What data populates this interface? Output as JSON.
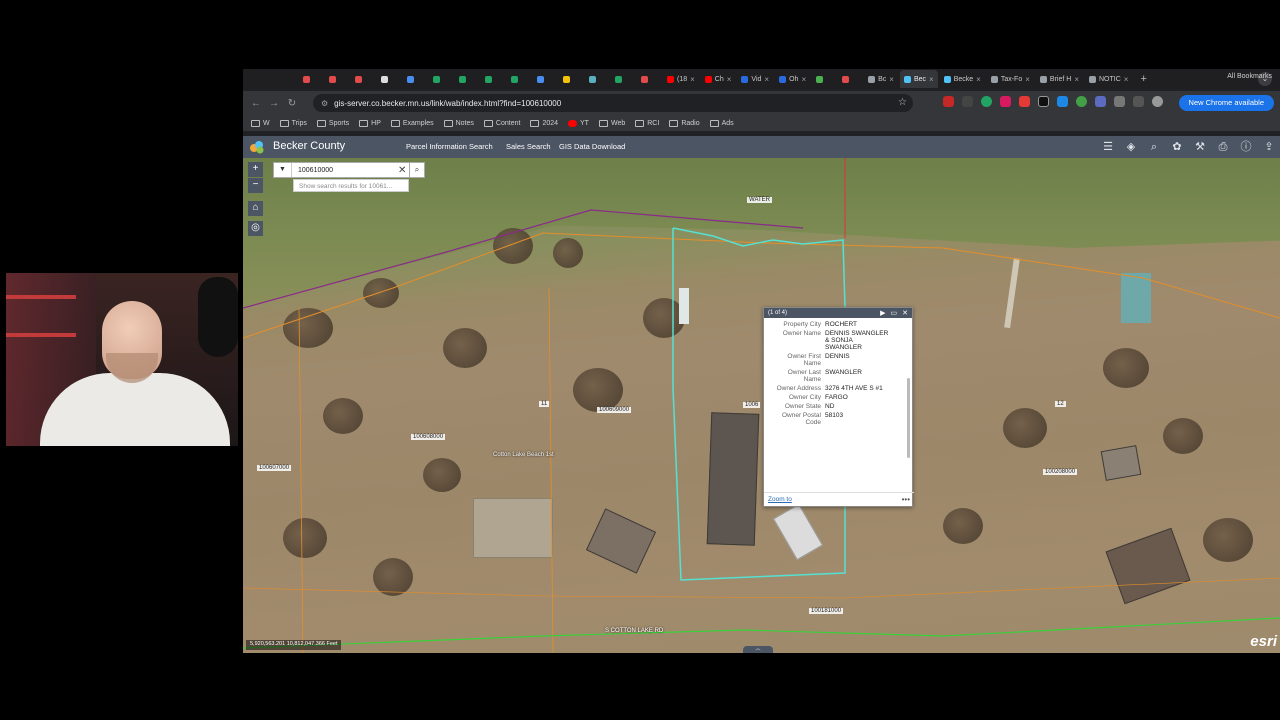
{
  "browser": {
    "tabs": [
      {
        "label": "",
        "color": "#e14b4b"
      },
      {
        "label": "",
        "color": "#e14b4b"
      },
      {
        "label": "",
        "color": "#e14b4b"
      },
      {
        "label": "",
        "color": "#dddddd"
      },
      {
        "label": "",
        "color": "#4a8df0"
      },
      {
        "label": "",
        "color": "#21a464"
      },
      {
        "label": "",
        "color": "#21a464"
      },
      {
        "label": "",
        "color": "#21a464"
      },
      {
        "label": "",
        "color": "#21a464"
      },
      {
        "label": "",
        "color": "#4a8df0"
      },
      {
        "label": "",
        "color": "#f4c20d"
      },
      {
        "label": "",
        "color": "#5ab0c0"
      },
      {
        "label": "",
        "color": "#21a464"
      },
      {
        "label": "",
        "color": "#e14b4b"
      },
      {
        "label": "(18",
        "color": "#ff0000"
      },
      {
        "label": "Ch",
        "color": "#ff0000"
      },
      {
        "label": "Vid",
        "color": "#2a6ae0"
      },
      {
        "label": "Oh",
        "color": "#2a6ae0"
      },
      {
        "label": "",
        "color": "#4caf50"
      },
      {
        "label": "",
        "color": "#e14b4b"
      },
      {
        "label": "Bc",
        "color": "#9aa0a6"
      },
      {
        "label": "Bec",
        "color": "#4fc3f7",
        "active": true
      },
      {
        "label": "Becke",
        "color": "#4fc3f7"
      },
      {
        "label": "Tax-Fo",
        "color": "#9aa0a6"
      },
      {
        "label": "Brief H",
        "color": "#9aa0a6"
      },
      {
        "label": "NOTIC",
        "color": "#9aa0a6"
      }
    ],
    "url": "gis-server.co.becker.mn.us/link/wab/index.html?find=100610000",
    "update_button": "New Chrome available",
    "bookmarks": [
      "W",
      "Trips",
      "Sports",
      "HP",
      "Examples",
      "Notes",
      "Content",
      "2024",
      "YT",
      "Web",
      "RCI",
      "Radio",
      "Ads"
    ],
    "all_bookmarks": "All Bookmarks"
  },
  "app": {
    "title": "Becker County",
    "links": [
      "Parcel Information Search",
      "Sales Search",
      "GIS Data Download"
    ],
    "header_icons": [
      "list-icon",
      "layers-icon",
      "search-map-icon",
      "gallery-icon",
      "draw-icon",
      "print-icon",
      "info-icon",
      "share-icon"
    ]
  },
  "map": {
    "search_value": "100610000",
    "search_suggestion": "Show search results for 10061...",
    "labels": {
      "water": "WATER",
      "p1": "100609000",
      "p2": "100608000",
      "p3": "100607000",
      "p4": "100610000",
      "p5": "100181000",
      "p6": "100208000",
      "n11": "11",
      "n12": "12",
      "beach": "Cotton Lake Beach 1st",
      "road": "S COTTON LAKE RD"
    },
    "coordinates": "5,920,563.201 10,812,047.366 Feet",
    "attribution": "esri",
    "popup": {
      "count": "(1 of 4)",
      "rows": [
        {
          "key": "Property City",
          "value": "ROCHERT"
        },
        {
          "key": "Owner Name",
          "value": "DENNIS SWANGLER & SONJA SWANGLER"
        },
        {
          "key": "Owner First Name",
          "value": "DENNIS"
        },
        {
          "key": "Owner Last Name",
          "value": "SWANGLER"
        },
        {
          "key": "Owner Address",
          "value": "3276 4TH AVE S #1"
        },
        {
          "key": "Owner City",
          "value": "FARGO"
        },
        {
          "key": "Owner State",
          "value": "ND"
        },
        {
          "key": "Owner Postal Code",
          "value": "58103"
        }
      ],
      "zoom_to": "Zoom to"
    }
  }
}
